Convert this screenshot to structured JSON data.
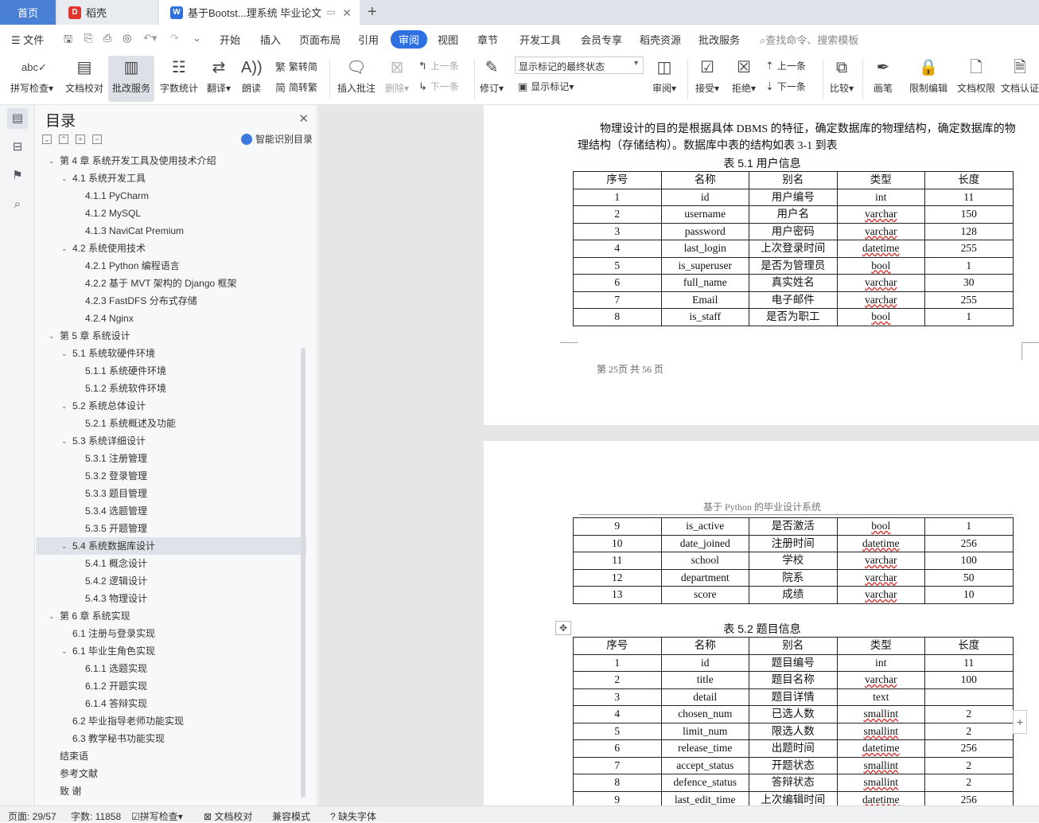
{
  "tabs": {
    "home": "首页",
    "daoke": "稻壳",
    "doc": "基于Bootst...理系统 毕业论文",
    "add": "+"
  },
  "menu": {
    "file": "文件",
    "items": [
      "开始",
      "插入",
      "页面布局",
      "引用",
      "审阅",
      "视图",
      "章节",
      "开发工具",
      "会员专享",
      "稻壳资源",
      "批改服务"
    ],
    "search": "查找命令、搜索模板"
  },
  "ribbon": {
    "spell": "拼写检查",
    "doc_check": "文档校对",
    "pizhu": "批改服务",
    "word_count": "字数统计",
    "translate": "翻译",
    "read": "朗读",
    "trad": "繁转简",
    "simp": "简转繁",
    "insert_comment": "插入批注",
    "delete": "删除",
    "prev": "上一条",
    "next": "下一条",
    "revise": "修订",
    "state_value": "显示标记的最终状态",
    "show_marks": "显示标记",
    "review": "审阅",
    "accept": "接受",
    "reject": "拒绝",
    "prev2": "上一条",
    "next2": "下一条",
    "compare": "比较",
    "pen": "画笔",
    "restrict": "限制编辑",
    "doc_perm": "文档权限",
    "doc_auth": "文档认证"
  },
  "toc": {
    "title": "目录",
    "smart": "智能识别目录",
    "items": [
      {
        "t": "第 4 章  系统开发工具及使用技术介绍",
        "lv": 0,
        "car": "v"
      },
      {
        "t": "4.1  系统开发工具",
        "lv": 1,
        "car": "v"
      },
      {
        "t": "4.1.1 PyCharm",
        "lv": 2
      },
      {
        "t": "4.1.2 MySQL",
        "lv": 2
      },
      {
        "t": "4.1.3 NaviCat Premium",
        "lv": 2
      },
      {
        "t": "4.2  系统使用技术",
        "lv": 1,
        "car": "v"
      },
      {
        "t": "4.2.1 Python 编程语言",
        "lv": 2
      },
      {
        "t": "4.2.2 基于 MVT 架构的 Django 框架",
        "lv": 2
      },
      {
        "t": "4.2.3 FastDFS 分布式存储",
        "lv": 2
      },
      {
        "t": "4.2.4 Nginx",
        "lv": 2
      },
      {
        "t": "第 5 章  系统设计",
        "lv": 0,
        "car": "v"
      },
      {
        "t": "5.1 系统软硬件环境",
        "lv": 1,
        "car": "v"
      },
      {
        "t": "5.1.1  系统硬件环境",
        "lv": 2
      },
      {
        "t": "5.1.2  系统软件环境",
        "lv": 2
      },
      {
        "t": "5.2 系统总体设计",
        "lv": 1,
        "car": "v"
      },
      {
        "t": "5.2.1 系统概述及功能",
        "lv": 2
      },
      {
        "t": "5.3 系统详细设计",
        "lv": 1,
        "car": "v"
      },
      {
        "t": "5.3.1  注册管理",
        "lv": 2
      },
      {
        "t": "5.3.2  登录管理",
        "lv": 2
      },
      {
        "t": "5.3.3  题目管理",
        "lv": 2
      },
      {
        "t": "5.3.4  选题管理",
        "lv": 2
      },
      {
        "t": "5.3.5  开题管理",
        "lv": 2
      },
      {
        "t": "5.4 系统数据库设计",
        "lv": 1,
        "car": "v",
        "active": true
      },
      {
        "t": "5.4.1  概念设计",
        "lv": 2
      },
      {
        "t": "5.4.2  逻辑设计",
        "lv": 2
      },
      {
        "t": "5.4.3  物理设计",
        "lv": 2
      },
      {
        "t": "第 6 章  系统实现",
        "lv": 0,
        "car": "v"
      },
      {
        "t": "6.1  注册与登录实现",
        "lv": 1
      },
      {
        "t": "6.1 毕业生角色实现",
        "lv": 1,
        "car": "v"
      },
      {
        "t": "6.1.1  选题实现",
        "lv": 2
      },
      {
        "t": "6.1.2  开题实现",
        "lv": 2
      },
      {
        "t": "6.1.4  答辩实现",
        "lv": 2
      },
      {
        "t": "6.2  毕业指导老师功能实现",
        "lv": 1
      },
      {
        "t": "6.3  教学秘书功能实现",
        "lv": 1
      },
      {
        "t": "结束语",
        "lv": 0
      },
      {
        "t": "参考文献",
        "lv": 0
      },
      {
        "t": "致  谢",
        "lv": 0
      }
    ]
  },
  "doc": {
    "para1": "物理设计的目的是根据具体 DBMS 的特征，确定数据库的物理结构，确定数据库的物",
    "para2": "理结构（存储结构）。数据库中表的结构如表 3-1 到表",
    "cap1": "表 5.1 用户信息",
    "header": [
      "序号",
      "名称",
      "别名",
      "类型",
      "长度"
    ],
    "table1": [
      [
        "1",
        "id",
        "用户编号",
        "int",
        "11"
      ],
      [
        "2",
        "username",
        "用户名",
        "varchar",
        "150"
      ],
      [
        "3",
        "password",
        "用户密码",
        "varchar",
        "128"
      ],
      [
        "4",
        "last_login",
        "上次登录时间",
        "datetime",
        "255"
      ],
      [
        "5",
        "is_superuser",
        "是否为管理员",
        "bool",
        "1"
      ],
      [
        "6",
        "full_name",
        "真实姓名",
        "varchar",
        "30"
      ],
      [
        "7",
        "Email",
        "电子邮件",
        "varchar",
        "255"
      ],
      [
        "8",
        "is_staff",
        "是否为职工",
        "bool",
        "1"
      ]
    ],
    "footer": "第 25页  共 56 页",
    "page_header": "基于 Python 的毕业设计系统",
    "table1b": [
      [
        "9",
        "is_active",
        "是否激活",
        "bool",
        "1"
      ],
      [
        "10",
        "date_joined",
        "注册时间",
        "datetime",
        "256"
      ],
      [
        "11",
        "school",
        "学校",
        "varchar",
        "100"
      ],
      [
        "12",
        "department",
        "院系",
        "varchar",
        "50"
      ],
      [
        "13",
        "score",
        "成绩",
        "varchar",
        "10"
      ]
    ],
    "cap2": "表 5.2 题目信息",
    "table2": [
      [
        "1",
        "id",
        "题目编号",
        "int",
        "11"
      ],
      [
        "2",
        "title",
        "题目名称",
        "varchar",
        "100"
      ],
      [
        "3",
        "detail",
        "题目详情",
        "text",
        ""
      ],
      [
        "4",
        "chosen_num",
        "已选人数",
        "smallint",
        "2"
      ],
      [
        "5",
        "limit_num",
        "限选人数",
        "smallint",
        "2"
      ],
      [
        "6",
        "release_time",
        "出题时间",
        "datetime",
        "256"
      ],
      [
        "7",
        "accept_status",
        "开题状态",
        "smallint",
        "2"
      ],
      [
        "8",
        "defence_status",
        "答辩状态",
        "smallint",
        "2"
      ],
      [
        "9",
        "last_edit_time",
        "上次编辑时间",
        "datetime",
        "256"
      ]
    ]
  },
  "status": {
    "page": "页面: 29/57",
    "words": "字数: 11858",
    "spell": "拼写检查",
    "check": "文档校对",
    "compat": "兼容模式",
    "missing": "缺失字体"
  },
  "colors": {
    "accent": "#2f6fe0"
  }
}
